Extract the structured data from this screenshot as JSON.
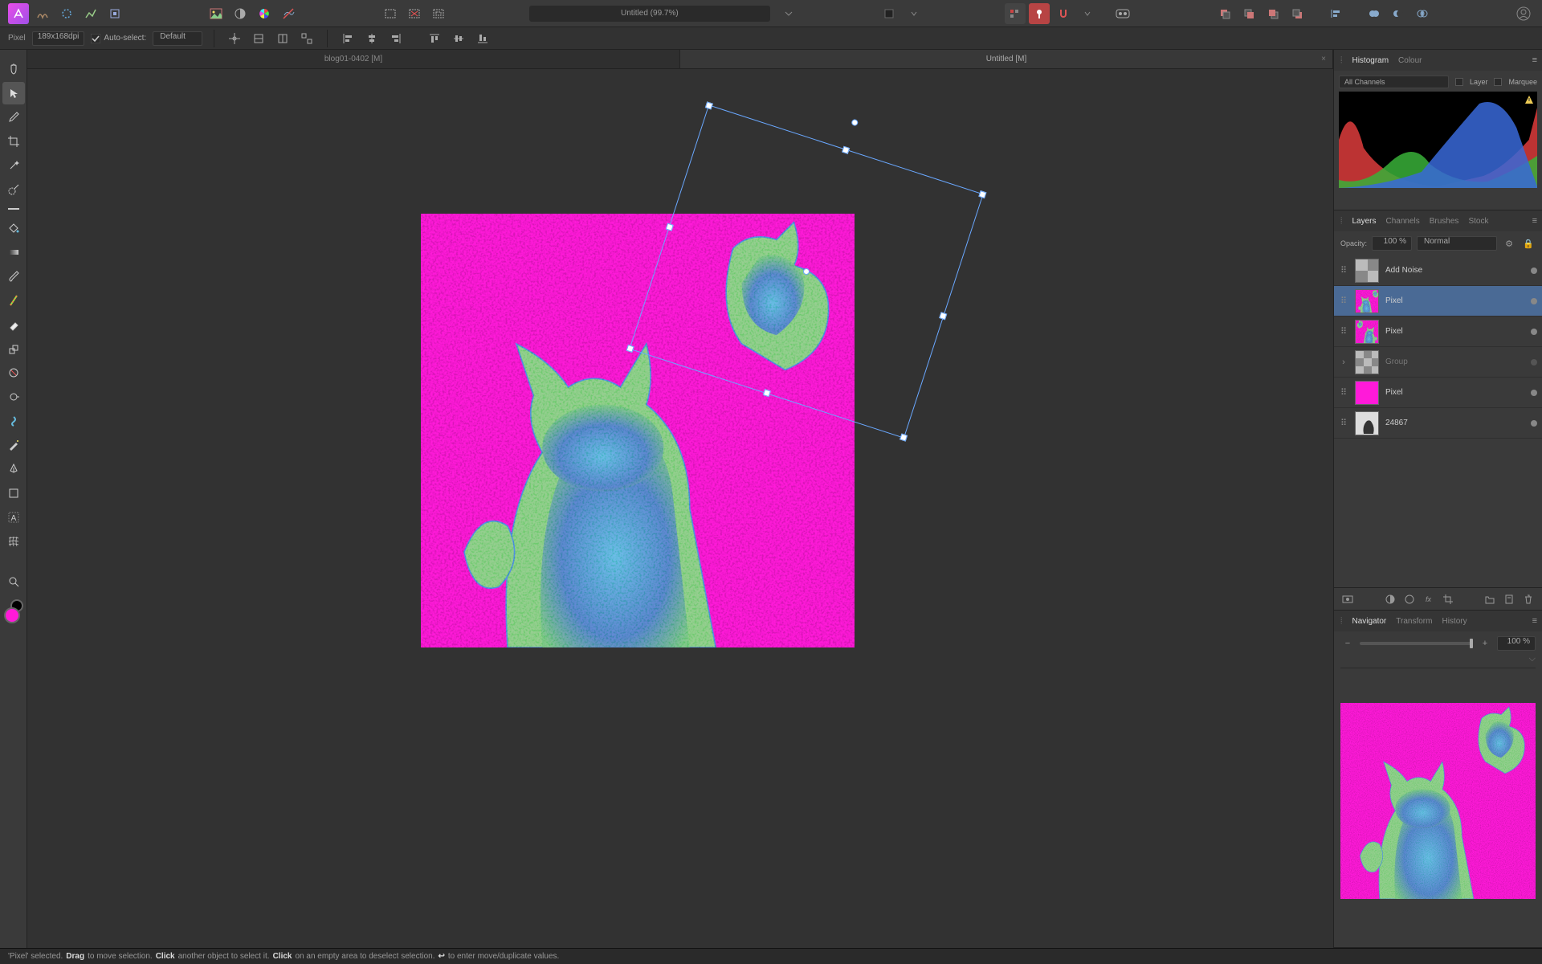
{
  "app": {
    "doc_title": "Untitled (99.7%)"
  },
  "secondbar": {
    "layer_type": "Pixel",
    "res": "189x168dpi",
    "auto_select_label": "Auto-select:",
    "auto_select_value": "Default"
  },
  "tabs": [
    {
      "label": "blog01-0402 [M]",
      "active": false
    },
    {
      "label": "Untitled [M]",
      "active": true
    }
  ],
  "panels": {
    "histogram_tabs": [
      "Histogram",
      "Colour"
    ],
    "histogram_channel": "All Channels",
    "histogram_layer": "Layer",
    "histogram_marquee": "Marquee",
    "layers_tabs": [
      "Layers",
      "Channels",
      "Brushes",
      "Stock"
    ],
    "opacity_label": "Opacity:",
    "opacity_value": "100 %",
    "blend_mode": "Normal",
    "layers": [
      {
        "name": "Add Noise",
        "selected": false,
        "thumb": "fx"
      },
      {
        "name": "Pixel",
        "selected": true,
        "thumb": "cat1"
      },
      {
        "name": "Pixel",
        "selected": false,
        "thumb": "cat2"
      },
      {
        "name": "Group",
        "selected": false,
        "thumb": "checker",
        "expandable": true,
        "dim": true
      },
      {
        "name": "Pixel",
        "selected": false,
        "thumb": "magenta"
      },
      {
        "name": "24867",
        "selected": false,
        "thumb": "bw"
      }
    ],
    "nav_tabs": [
      "Navigator",
      "Transform",
      "History"
    ],
    "nav_zoom": "100 %"
  },
  "status": {
    "s1": "'Pixel' selected. ",
    "s2": "Drag",
    "s3": " to move selection. ",
    "s4": "Click",
    "s5": " another object to select it. ",
    "s6": "Click",
    "s7": " on an empty area to deselect selection. ",
    "s8": "↩",
    "s9": " to enter move/duplicate values."
  },
  "colors": {
    "swatch_fg": "#ff22d8",
    "swatch_bg": "#000000"
  }
}
